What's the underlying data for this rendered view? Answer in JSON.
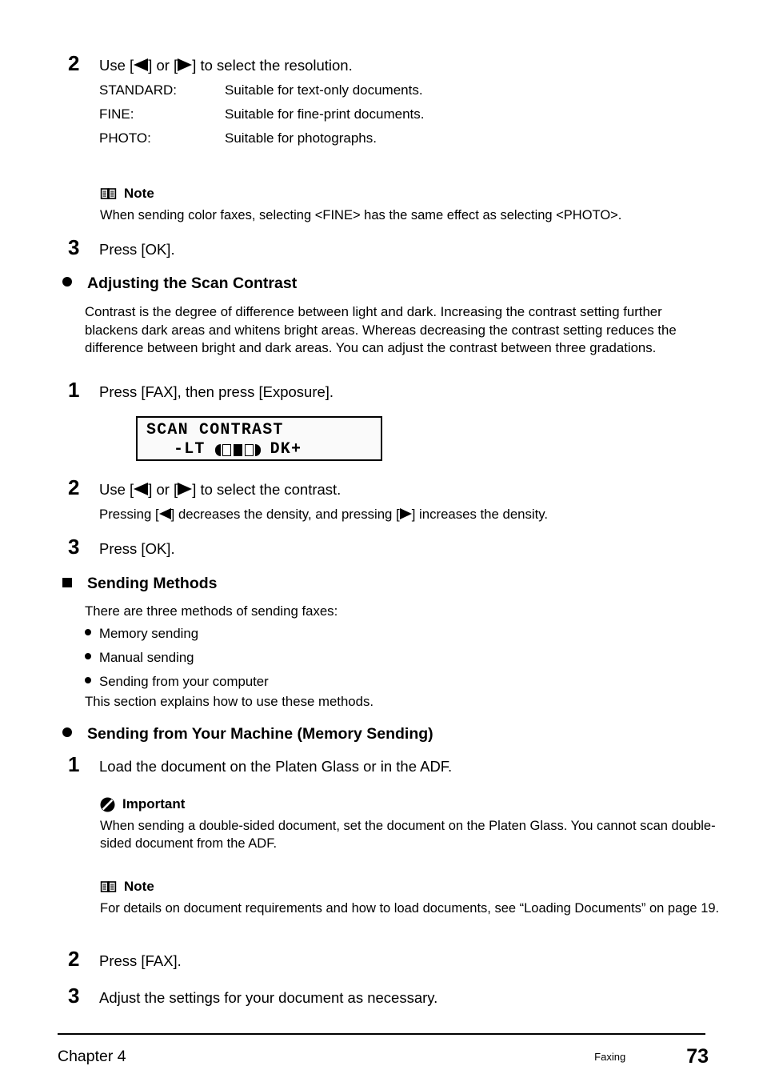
{
  "doc": {
    "steps_resolution": {
      "number": "2",
      "title_pre": "Use [",
      "title_mid": "] or [",
      "title_post": "] to select the resolution.",
      "definitions": [
        {
          "term": "STANDARD:",
          "desc": "Suitable for text-only documents."
        },
        {
          "term": "FINE:",
          "desc": "Suitable for fine-print documents."
        },
        {
          "term": "PHOTO:",
          "desc": "Suitable for photographs."
        }
      ]
    },
    "note_resolution": {
      "icon": "open-book-icon",
      "label": "Note",
      "body": "When sending color faxes, selecting <FINE> has the same effect as selecting <PHOTO>."
    },
    "step_ok_1": {
      "number": "3",
      "text": "Press [OK]."
    },
    "heading_contrast": {
      "bullet": "round-bullet",
      "text": "Adjusting the Scan Contrast"
    },
    "para_contrast": "Contrast is the degree of difference between light and dark. Increasing the contrast setting further blackens dark areas and whitens bright areas. Whereas decreasing the contrast setting reduces the difference between bright and dark areas. You can adjust the contrast between three gradations.",
    "step_exposure": {
      "number": "1",
      "text": "Press [FAX], then press [Exposure]."
    },
    "lcd": {
      "line1": "SCAN CONTRAST",
      "light_label": "-LT",
      "dark_label": "DK+",
      "gauge_cells": [
        0,
        1,
        0
      ],
      "gauge_selected_index": 1
    },
    "step_contrast_select": {
      "number": "2",
      "title_pre": "Use [",
      "title_mid": "] or [",
      "title_post": "] to select the contrast.",
      "sub_pre": "Pressing [",
      "sub_mid": "] decreases the density, and pressing [",
      "sub_post": "] increases the density."
    },
    "step_ok_2": {
      "number": "3",
      "text": "Press [OK]."
    },
    "heading_sending_methods": {
      "bullet": "square-bullet",
      "text": "Sending Methods"
    },
    "intro_sending_methods": "There are three methods of sending faxes:",
    "methods": [
      "Memory sending",
      "Manual sending",
      "Sending from your computer"
    ],
    "outro_sending_methods": "This section explains how to use these methods.",
    "heading_memory_sending": {
      "bullet": "round-bullet",
      "text": "Sending from Your Machine (Memory Sending)"
    },
    "step_load": {
      "number": "1",
      "text": "Load the document on the Platen Glass or in the ADF."
    },
    "important_block": {
      "icon": "no-entry-slash-icon",
      "label": "Important",
      "body": "When sending a double-sided document, set the document on the Platen Glass. You cannot scan double-sided document from the ADF."
    },
    "note_loading": {
      "icon": "open-book-icon",
      "label": "Note",
      "body": "For details on document requirements and how to load documents, see “Loading Documents” on page 19."
    },
    "step_press_fax": {
      "number": "2",
      "text": "Press [FAX]."
    },
    "step_adjust": {
      "number": "3",
      "text": "Adjust the settings for your document as necessary."
    },
    "footer": {
      "chapter": "Chapter 4",
      "section": "Faxing",
      "page": "73"
    }
  }
}
